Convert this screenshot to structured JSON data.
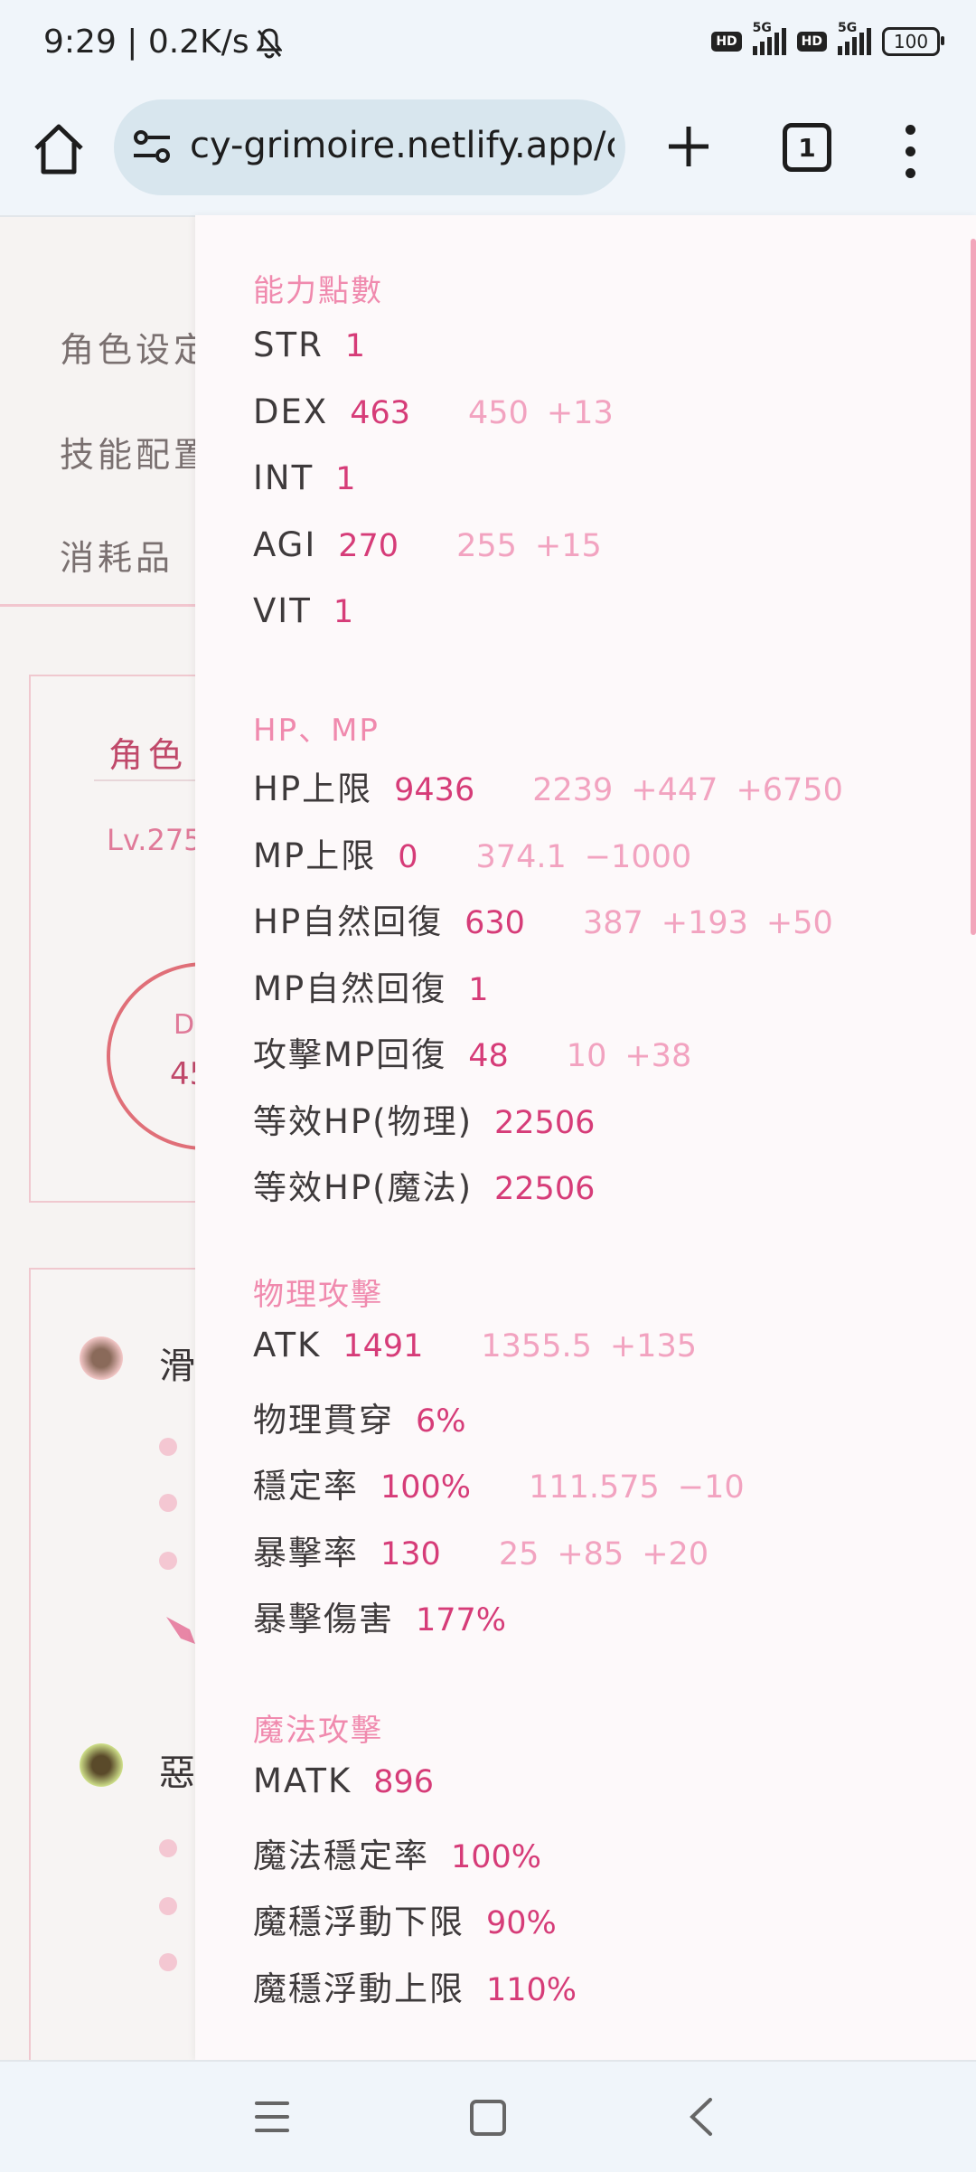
{
  "status_bar": {
    "time": "9:29 | 0.2K/s",
    "network_1": "5G",
    "network_2": "5G",
    "hd": "HD",
    "battery": "100"
  },
  "browser": {
    "url": "cy-grimoire.netlify.app/c",
    "tab_count": "1"
  },
  "background": {
    "nav_items": [
      "角色设定",
      "技能配置",
      "消耗品"
    ],
    "card_title": "角色",
    "level": "Lv.275",
    "circle_label": "D",
    "circle_value": "45",
    "items": [
      "滑",
      "惡"
    ]
  },
  "stats": {
    "ability": {
      "title": "能力點數",
      "rows": [
        {
          "label": "STR",
          "value": "1",
          "details": []
        },
        {
          "label": "DEX",
          "value": "463",
          "details": [
            "450",
            "+13"
          ]
        },
        {
          "label": "INT",
          "value": "1",
          "details": []
        },
        {
          "label": "AGI",
          "value": "270",
          "details": [
            "255",
            "+15"
          ]
        },
        {
          "label": "VIT",
          "value": "1",
          "details": []
        }
      ]
    },
    "hpmp": {
      "title": "HP、MP",
      "rows": [
        {
          "label": "HP上限",
          "value": "9436",
          "details": [
            "2239",
            "+447",
            "+6750"
          ]
        },
        {
          "label": "MP上限",
          "value": "0",
          "details": [
            "374.1",
            "−1000"
          ]
        },
        {
          "label": "HP自然回復",
          "value": "630",
          "details": [
            "387",
            "+193",
            "+50"
          ]
        },
        {
          "label": "MP自然回復",
          "value": "1",
          "details": []
        },
        {
          "label": "攻擊MP回復",
          "value": "48",
          "details": [
            "10",
            "+38"
          ]
        },
        {
          "label": "等效HP(物理)",
          "value": "22506",
          "details": []
        },
        {
          "label": "等效HP(魔法)",
          "value": "22506",
          "details": []
        }
      ]
    },
    "physical": {
      "title": "物理攻擊",
      "rows": [
        {
          "label": "ATK",
          "value": "1491",
          "details": [
            "1355.5",
            "+135"
          ]
        },
        {
          "label": "物理貫穿",
          "value": "6%",
          "details": []
        },
        {
          "label": "穩定率",
          "value": "100%",
          "details": [
            "111.575",
            "−10"
          ]
        },
        {
          "label": "暴擊率",
          "value": "130",
          "details": [
            "25",
            "+85",
            "+20"
          ]
        },
        {
          "label": "暴擊傷害",
          "value": "177%",
          "details": []
        }
      ]
    },
    "magic": {
      "title": "魔法攻擊",
      "rows": [
        {
          "label": "MATK",
          "value": "896",
          "details": []
        },
        {
          "label": "魔法穩定率",
          "value": "100%",
          "details": []
        },
        {
          "label": "魔穩浮動下限",
          "value": "90%",
          "details": []
        },
        {
          "label": "魔穩浮動上限",
          "value": "110%",
          "details": []
        }
      ]
    }
  },
  "colors": {
    "accent": "#d63c78",
    "section": "#f08aae",
    "detail": "#f2a3c0"
  }
}
